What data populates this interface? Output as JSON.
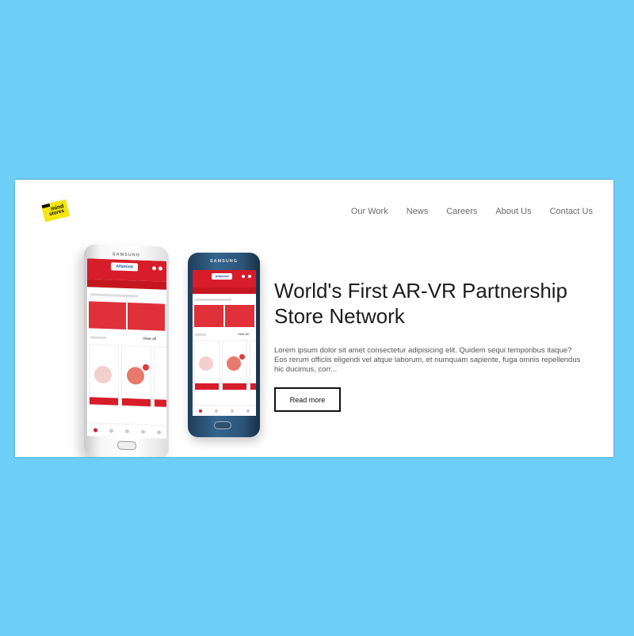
{
  "brand": {
    "logo_line1": "mind",
    "logo_line2": "stores"
  },
  "nav": {
    "items": [
      "Our Work",
      "News",
      "Careers",
      "About Us",
      "Contact Us"
    ]
  },
  "hero": {
    "headline_line1": "World's First AR-VR Partnership",
    "headline_line2": "Store Network",
    "body": "Lorem ipsum dolor sit amet consectetur adipisicing elit. Quidem sequi temporibus itaque? Eos rerum officiis eligendi vel atque laborum, et numquam sapiente, fuga omnis repellendus hic ducimus, corr...",
    "cta_label": "Read more"
  },
  "phones": {
    "white_brand": "SAMSUNG",
    "blue_brand": "SAMSUNG",
    "app_logo": "Alfamind",
    "view_all": "View all"
  },
  "colors": {
    "background": "#6ecff6",
    "card": "#ffffff",
    "app_red": "#d71c2a",
    "logo_yellow": "#f4e513"
  }
}
